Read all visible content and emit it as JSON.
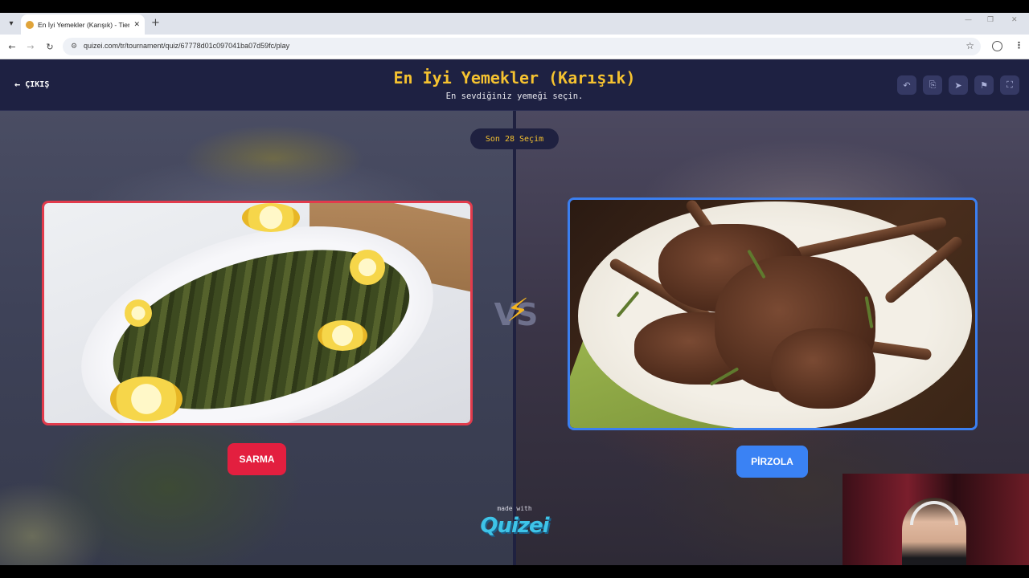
{
  "browser": {
    "tab_title": "En İyi Yemekler (Karışık) - Tier L",
    "url": "quizei.com/tr/tournament/quiz/67778d01c097041ba07d59fc/play"
  },
  "header": {
    "exit_label": "ÇIKIŞ",
    "title": "En İyi Yemekler (Karışık)",
    "subtitle": "En sevdiğiniz yemeği seçin."
  },
  "tools": [
    "undo-icon",
    "share-icon",
    "send-icon",
    "flag-icon",
    "fullscreen-icon"
  ],
  "arena": {
    "recent_label": "Son 28 Seçim",
    "vs_label": "VS",
    "left": {
      "name": "SARMA",
      "border_color": "#e23b4c",
      "button_color": "#e31f3f"
    },
    "right": {
      "name": "PİRZOLA",
      "border_color": "#3b7ff0",
      "button_color": "#3a82f4"
    }
  },
  "footer": {
    "made_with": "made with",
    "brand": "Quizei"
  },
  "colors": {
    "accent": "#f5c230",
    "header_bg": "#1e2142"
  }
}
